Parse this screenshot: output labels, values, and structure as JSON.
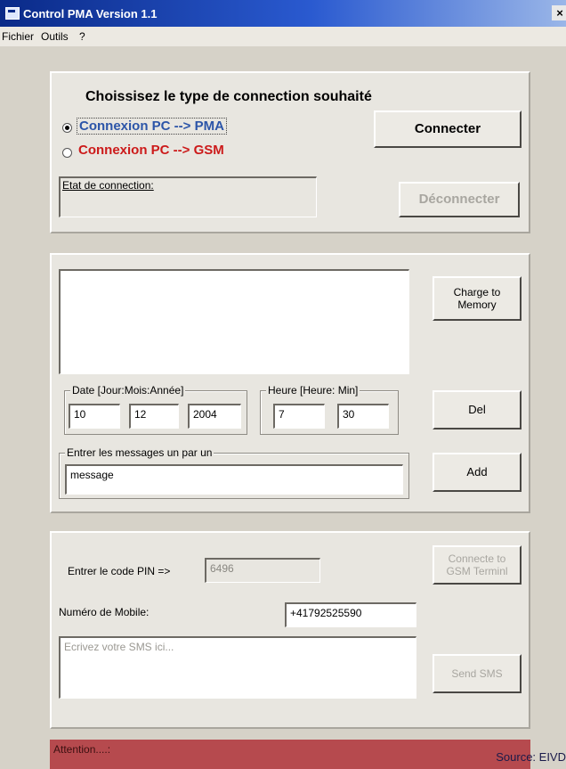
{
  "window": {
    "title": "Control PMA Version 1.1",
    "close_symbol": "×"
  },
  "menu": {
    "items": [
      "Fichier",
      "Outils",
      "?"
    ]
  },
  "connection": {
    "heading": "Choissisez le type de connection souhaité",
    "option_pma": "Connexion PC --> PMA",
    "option_gsm": "Connexion PC --> GSM",
    "selected": "option_pma",
    "connect_label": "Connecter",
    "disconnect_label": "Déconnecter",
    "status_label": "Etat de connection:",
    "status_value": ""
  },
  "messages": {
    "list_value": "",
    "charge_label": "Charge to\nMemory",
    "date_legend": "Date [Jour:Mois:Année]",
    "day": "10",
    "month": "12",
    "year": "2004",
    "time_legend": "Heure [Heure: Min]",
    "hour": "7",
    "minute": "30",
    "del_label": "Del",
    "entry_legend": "Entrer les messages un par un",
    "entry_value": "message",
    "add_label": "Add"
  },
  "gsm": {
    "pin_label": "Entrer le code PIN =>",
    "pin_value": "6496",
    "connect_gsm_label": "Connecte to\nGSM Terminl",
    "mobile_label": "Numéro de Mobile:",
    "mobile_value": "+41792525590",
    "sms_placeholder": "Ecrivez votre SMS ici...",
    "send_label": "Send SMS"
  },
  "footer": {
    "attention_label": "Attention....:",
    "source_text": "Source: EIVD"
  },
  "colors": {
    "pma_option": "#2c55a8",
    "gsm_option": "#cc1a1a",
    "attention_bar": "#b64a4e",
    "titlebar": "#0a2a88"
  }
}
